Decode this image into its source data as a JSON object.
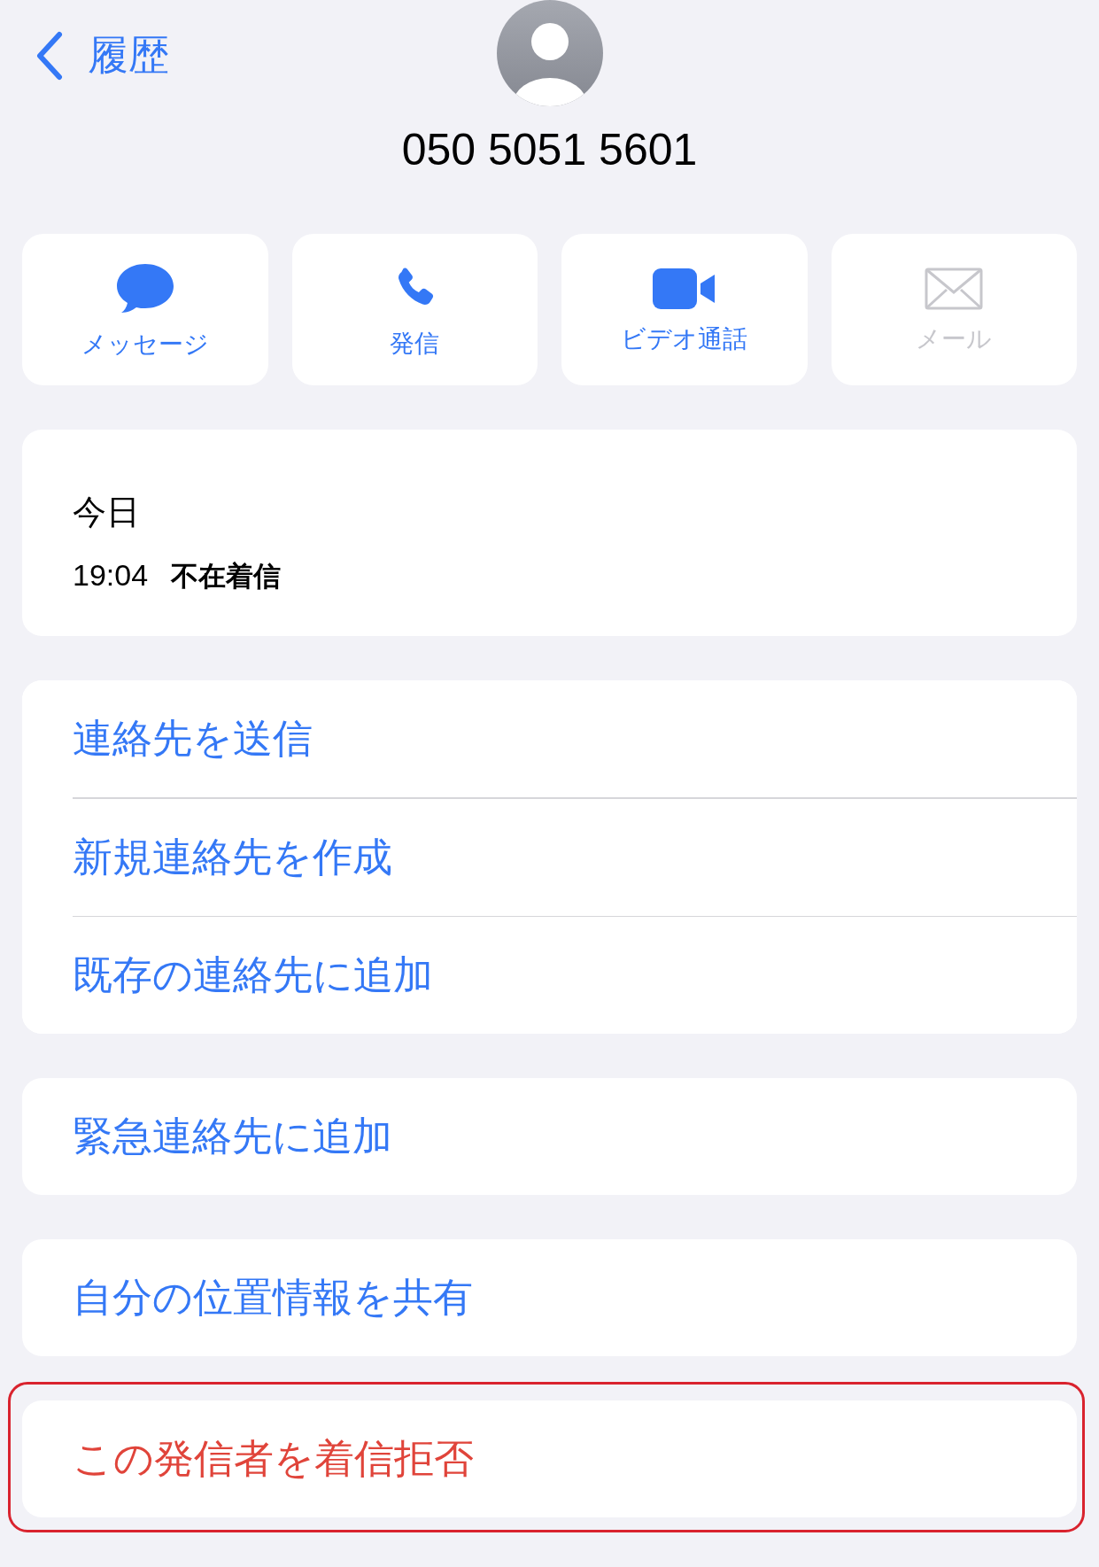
{
  "nav": {
    "back_label": "履歴"
  },
  "contact": {
    "number": "050 5051 5601"
  },
  "actions": [
    {
      "kind": "message",
      "label": "メッセージ",
      "disabled": false
    },
    {
      "kind": "call",
      "label": "発信",
      "disabled": false
    },
    {
      "kind": "video",
      "label": "ビデオ通話",
      "disabled": false
    },
    {
      "kind": "mail",
      "label": "メール",
      "disabled": true
    }
  ],
  "history": {
    "day": "今日",
    "entries": [
      {
        "time": "19:04",
        "type": "不在着信"
      }
    ]
  },
  "groups": [
    {
      "highlighted": false,
      "items": [
        {
          "label": "連絡先を送信",
          "kind": "normal"
        },
        {
          "label": "新規連絡先を作成",
          "kind": "normal"
        },
        {
          "label": "既存の連絡先に追加",
          "kind": "normal"
        }
      ]
    },
    {
      "highlighted": false,
      "items": [
        {
          "label": "緊急連絡先に追加",
          "kind": "normal"
        }
      ]
    },
    {
      "highlighted": false,
      "items": [
        {
          "label": "自分の位置情報を共有",
          "kind": "normal"
        }
      ]
    },
    {
      "highlighted": true,
      "items": [
        {
          "label": "この発信者を着信拒否",
          "kind": "destructive"
        }
      ]
    }
  ]
}
